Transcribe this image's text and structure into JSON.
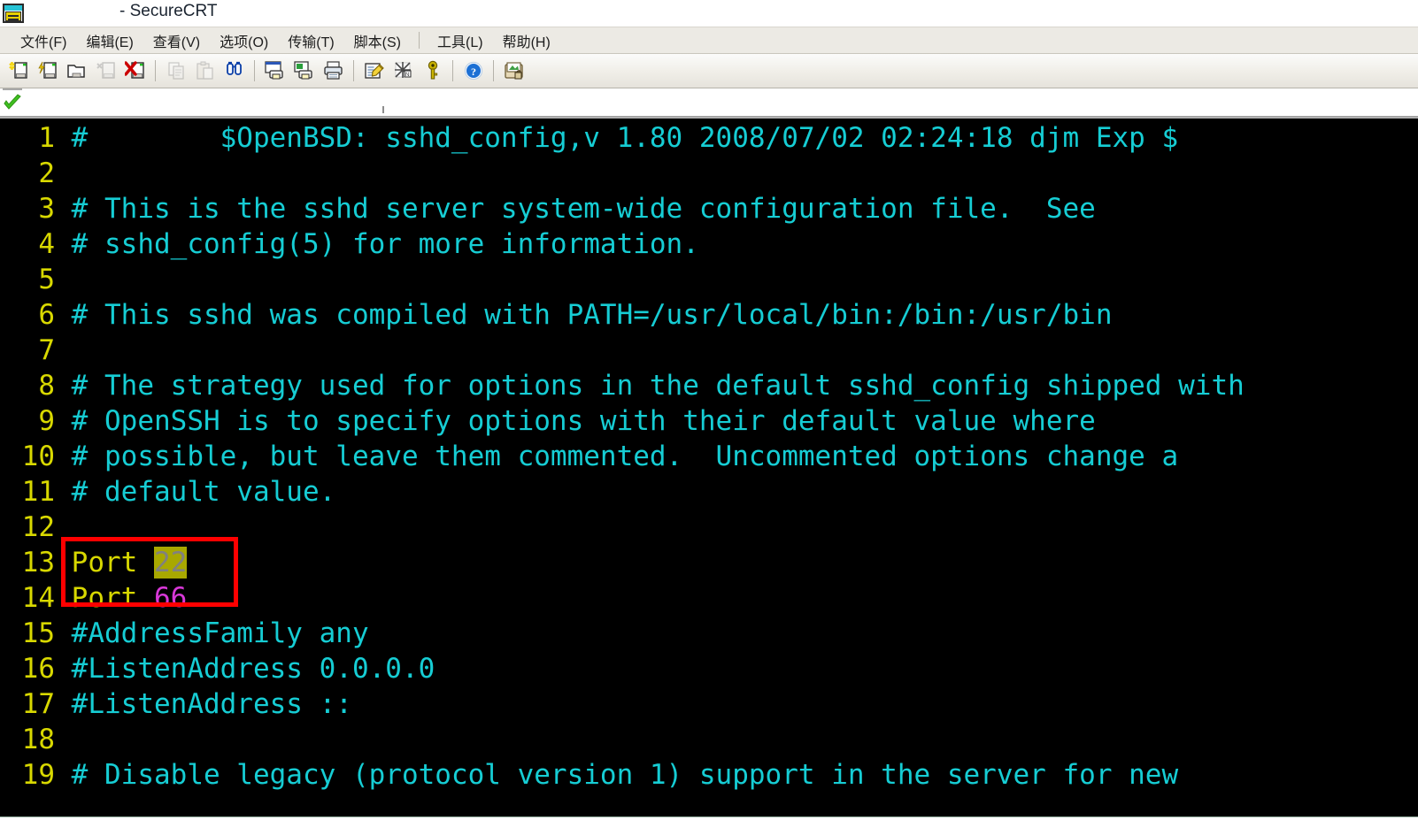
{
  "window": {
    "title": "- SecureCRT",
    "icon": "securecrt-app-icon"
  },
  "menubar": {
    "items": [
      {
        "label": "文件(F)",
        "name": "menu-file"
      },
      {
        "label": "编辑(E)",
        "name": "menu-edit"
      },
      {
        "label": "查看(V)",
        "name": "menu-view"
      },
      {
        "label": "选项(O)",
        "name": "menu-options"
      },
      {
        "label": "传输(T)",
        "name": "menu-transfer"
      },
      {
        "label": "脚本(S)",
        "name": "menu-script"
      },
      {
        "separator": true
      },
      {
        "label": "工具(L)",
        "name": "menu-tools"
      },
      {
        "label": "帮助(H)",
        "name": "menu-help"
      }
    ]
  },
  "toolbar": {
    "buttons": [
      {
        "icon": "new-session-icon",
        "name": "toolbar-new-session"
      },
      {
        "icon": "quick-connect-icon",
        "name": "toolbar-quick-connect"
      },
      {
        "icon": "connect-folder-icon",
        "name": "toolbar-connect-folder"
      },
      {
        "icon": "connect-sftp-icon",
        "name": "toolbar-connect-sftp",
        "disabled": true
      },
      {
        "icon": "disconnect-icon",
        "name": "toolbar-disconnect"
      },
      {
        "separator": true
      },
      {
        "icon": "copy-icon",
        "name": "toolbar-copy",
        "disabled": true
      },
      {
        "icon": "paste-icon",
        "name": "toolbar-paste",
        "disabled": true
      },
      {
        "icon": "find-icon",
        "name": "toolbar-find"
      },
      {
        "separator": true
      },
      {
        "icon": "print-screen-icon",
        "name": "toolbar-print-screen"
      },
      {
        "icon": "print-selection-icon",
        "name": "toolbar-print-selection"
      },
      {
        "icon": "print-icon",
        "name": "toolbar-print"
      },
      {
        "separator": true
      },
      {
        "icon": "session-options-icon",
        "name": "toolbar-session-options"
      },
      {
        "icon": "protocol-icon",
        "name": "toolbar-protocol"
      },
      {
        "icon": "key-icon",
        "name": "toolbar-key"
      },
      {
        "separator": true
      },
      {
        "icon": "help-icon",
        "name": "toolbar-help"
      },
      {
        "separator": true
      },
      {
        "icon": "secure-lock-icon",
        "name": "toolbar-secure-lock"
      }
    ]
  },
  "tabstrip": {
    "tabs": [
      {
        "icon": "green-check-icon",
        "label": "",
        "name": "session-tab-1",
        "active": true
      }
    ]
  },
  "terminal": {
    "colors": {
      "background": "#000000",
      "line_number": "#d8d800",
      "comment": "#16cdd4",
      "keyword": "#d8d800",
      "value": "#d838d8",
      "selection_bg": "#a8a800",
      "selection_fg": "#808080",
      "annotation": "#ff0000"
    },
    "lines": [
      {
        "n": "1",
        "segments": [
          {
            "t": "#        $OpenBSD: sshd_config,v 1.80 2008/07/02 02:24:18 djm Exp $",
            "c": "comment"
          }
        ]
      },
      {
        "n": "2",
        "segments": [
          {
            "t": "",
            "c": "comment"
          }
        ]
      },
      {
        "n": "3",
        "segments": [
          {
            "t": "# This is the sshd server system-wide configuration file.  See",
            "c": "comment"
          }
        ]
      },
      {
        "n": "4",
        "segments": [
          {
            "t": "# sshd_config(5) for more information.",
            "c": "comment"
          }
        ]
      },
      {
        "n": "5",
        "segments": [
          {
            "t": "",
            "c": "comment"
          }
        ]
      },
      {
        "n": "6",
        "segments": [
          {
            "t": "# This sshd was compiled with PATH=/usr/local/bin:/bin:/usr/bin",
            "c": "comment"
          }
        ]
      },
      {
        "n": "7",
        "segments": [
          {
            "t": "",
            "c": "comment"
          }
        ]
      },
      {
        "n": "8",
        "segments": [
          {
            "t": "# The strategy used for options in the default sshd_config shipped with",
            "c": "comment"
          }
        ]
      },
      {
        "n": "9",
        "segments": [
          {
            "t": "# OpenSSH is to specify options with their default value where",
            "c": "comment"
          }
        ]
      },
      {
        "n": "10",
        "segments": [
          {
            "t": "# possible, but leave them commented.  Uncommented options change a",
            "c": "comment"
          }
        ]
      },
      {
        "n": "11",
        "segments": [
          {
            "t": "# default value.",
            "c": "comment"
          }
        ]
      },
      {
        "n": "12",
        "segments": [
          {
            "t": "",
            "c": "comment"
          }
        ]
      },
      {
        "n": "13",
        "segments": [
          {
            "t": "Port ",
            "c": "keyword"
          },
          {
            "t": "22",
            "c": "selection"
          }
        ]
      },
      {
        "n": "14",
        "segments": [
          {
            "t": "Port ",
            "c": "keyword"
          },
          {
            "t": "66",
            "c": "value"
          }
        ]
      },
      {
        "n": "15",
        "segments": [
          {
            "t": "#AddressFamily any",
            "c": "comment"
          }
        ]
      },
      {
        "n": "16",
        "segments": [
          {
            "t": "#ListenAddress 0.0.0.0",
            "c": "comment"
          }
        ]
      },
      {
        "n": "17",
        "segments": [
          {
            "t": "#ListenAddress ::",
            "c": "comment"
          }
        ]
      },
      {
        "n": "18",
        "segments": [
          {
            "t": "",
            "c": "comment"
          }
        ]
      },
      {
        "n": "19",
        "segments": [
          {
            "t": "# Disable legacy (protocol version 1) support in the server for new",
            "c": "comment"
          }
        ]
      }
    ],
    "annotation": {
      "type": "red-rectangle",
      "covers_lines": [
        "13",
        "14"
      ]
    }
  }
}
